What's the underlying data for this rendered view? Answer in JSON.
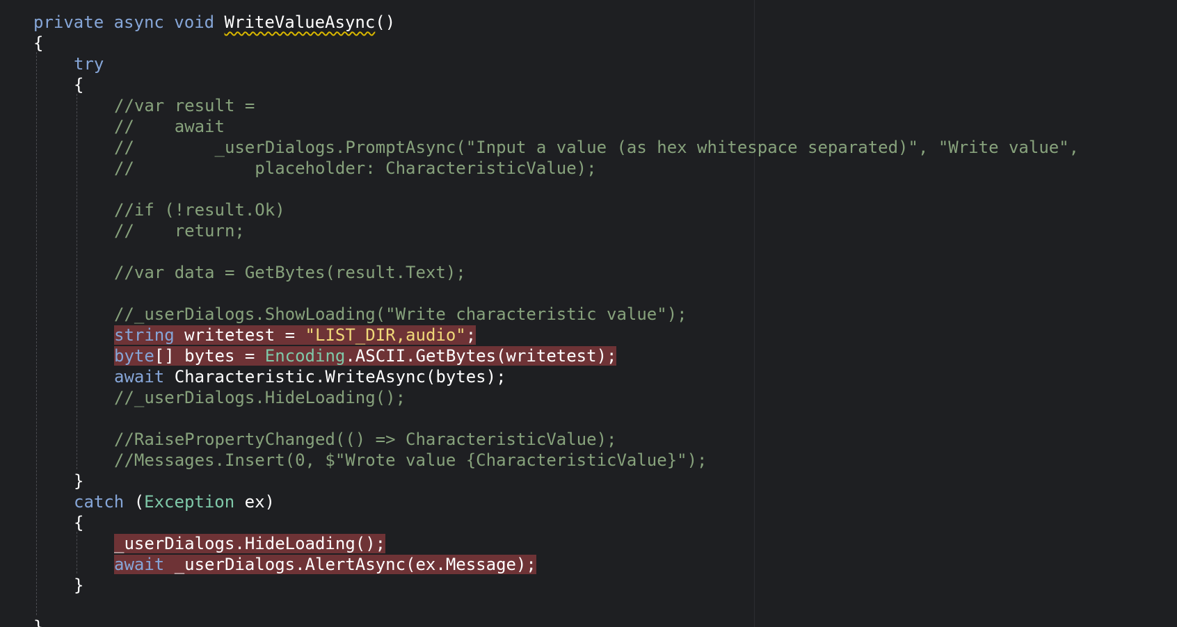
{
  "editor": {
    "lines": [
      {
        "indent": 1,
        "tokens": [
          {
            "t": "private ",
            "c": "kw"
          },
          {
            "t": "async ",
            "c": "kw"
          },
          {
            "t": "void ",
            "c": "kw"
          },
          {
            "t": "WriteValueAsync",
            "c": "pl",
            "squiggle": true
          },
          {
            "t": "()",
            "c": "pl"
          }
        ]
      },
      {
        "indent": 1,
        "tokens": [
          {
            "t": "{",
            "c": "pl"
          }
        ]
      },
      {
        "indent": 5,
        "tokens": [
          {
            "t": "try",
            "c": "kw"
          }
        ]
      },
      {
        "indent": 5,
        "tokens": [
          {
            "t": "{",
            "c": "pl"
          }
        ]
      },
      {
        "indent": 9,
        "tokens": [
          {
            "t": "//var result =",
            "c": "cm"
          }
        ]
      },
      {
        "indent": 9,
        "tokens": [
          {
            "t": "//    await",
            "c": "cm"
          }
        ]
      },
      {
        "indent": 9,
        "tokens": [
          {
            "t": "//        _userDialogs.PromptAsync(\"Input a value (as hex whitespace separated)\", \"Write value\",",
            "c": "cm"
          }
        ]
      },
      {
        "indent": 9,
        "tokens": [
          {
            "t": "//            placeholder: CharacteristicValue);",
            "c": "cm"
          }
        ]
      },
      {
        "indent": 9,
        "tokens": []
      },
      {
        "indent": 9,
        "tokens": [
          {
            "t": "//if (!result.Ok)",
            "c": "cm"
          }
        ]
      },
      {
        "indent": 9,
        "tokens": [
          {
            "t": "//    return;",
            "c": "cm"
          }
        ]
      },
      {
        "indent": 9,
        "tokens": []
      },
      {
        "indent": 9,
        "tokens": [
          {
            "t": "//var data = GetBytes(result.Text);",
            "c": "cm"
          }
        ]
      },
      {
        "indent": 9,
        "tokens": []
      },
      {
        "indent": 9,
        "tokens": [
          {
            "t": "//_userDialogs.ShowLoading(\"Write characteristic value\");",
            "c": "cm"
          }
        ]
      },
      {
        "indent": 9,
        "highlight": true,
        "tokens": [
          {
            "t": "string ",
            "c": "kw"
          },
          {
            "t": "writetest = ",
            "c": "pl"
          },
          {
            "t": "\"LIST_DIR,audio\"",
            "c": "str"
          },
          {
            "t": ";",
            "c": "pl"
          }
        ]
      },
      {
        "indent": 9,
        "highlight": true,
        "tokens": [
          {
            "t": "byte",
            "c": "kw"
          },
          {
            "t": "[] bytes = ",
            "c": "pl"
          },
          {
            "t": "Encoding",
            "c": "type"
          },
          {
            "t": ".ASCII.GetBytes(writetest);",
            "c": "pl"
          }
        ]
      },
      {
        "indent": 9,
        "tokens": [
          {
            "t": "await ",
            "c": "kw"
          },
          {
            "t": "Characteristic.WriteAsync(bytes);",
            "c": "pl"
          }
        ]
      },
      {
        "indent": 9,
        "tokens": [
          {
            "t": "//_userDialogs.HideLoading();",
            "c": "cm"
          }
        ]
      },
      {
        "indent": 9,
        "tokens": []
      },
      {
        "indent": 9,
        "tokens": [
          {
            "t": "//RaisePropertyChanged(() => CharacteristicValue);",
            "c": "cm"
          }
        ]
      },
      {
        "indent": 9,
        "tokens": [
          {
            "t": "//Messages.Insert(0, $\"Wrote value {CharacteristicValue}\");",
            "c": "cm"
          }
        ]
      },
      {
        "indent": 5,
        "tokens": [
          {
            "t": "}",
            "c": "pl"
          }
        ]
      },
      {
        "indent": 5,
        "tokens": [
          {
            "t": "catch ",
            "c": "kw"
          },
          {
            "t": "(",
            "c": "pl"
          },
          {
            "t": "Exception",
            "c": "type"
          },
          {
            "t": " ex)",
            "c": "pl"
          }
        ]
      },
      {
        "indent": 5,
        "tokens": [
          {
            "t": "{",
            "c": "pl"
          }
        ]
      },
      {
        "indent": 9,
        "highlight": true,
        "tokens": [
          {
            "t": "_userDialogs.HideLoading();",
            "c": "pl"
          }
        ]
      },
      {
        "indent": 9,
        "highlight": true,
        "tokens": [
          {
            "t": "await ",
            "c": "kw"
          },
          {
            "t": "_userDialogs.AlertAsync(ex.Message);",
            "c": "pl"
          }
        ]
      },
      {
        "indent": 5,
        "tokens": [
          {
            "t": "}",
            "c": "pl"
          }
        ]
      },
      {
        "indent": 5,
        "tokens": []
      },
      {
        "indent": 1,
        "tokens": [
          {
            "t": "}",
            "c": "pl"
          }
        ]
      }
    ]
  }
}
